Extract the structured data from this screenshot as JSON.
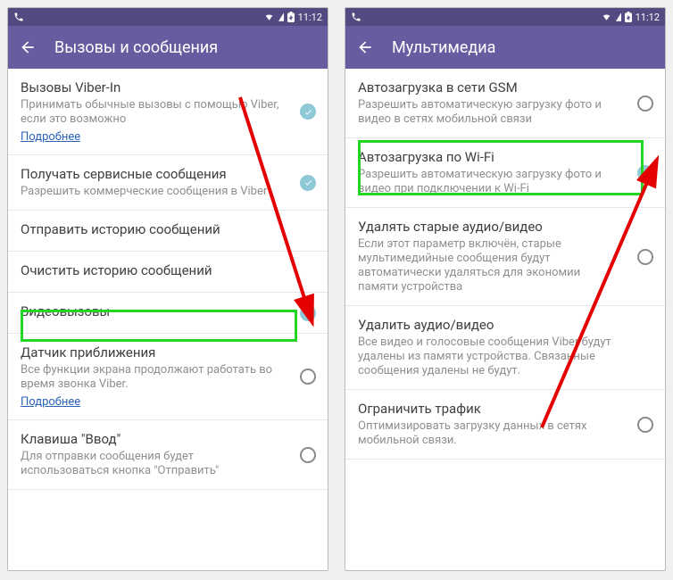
{
  "status": {
    "time": "11:12"
  },
  "left": {
    "title": "Вызовы и сообщения",
    "items": [
      {
        "title": "Вызовы Viber-In",
        "sub": "Принимать обычные вызовы с помощью Viber, если это возможно",
        "link": "Подробнее",
        "ctrl": "check"
      },
      {
        "title": "Получать сервисные сообщения",
        "sub": "Разрешить коммерческие сообщения в Viber",
        "ctrl": "check"
      },
      {
        "title": "Отправить историю сообщений",
        "ctrl": "none"
      },
      {
        "title": "Очистить историю сообщений",
        "ctrl": "none"
      },
      {
        "title": "Видеовызовы",
        "ctrl": "check"
      },
      {
        "title": "Датчик приближения",
        "sub": "Все функции экрана продолжают работать во время звонка Viber.",
        "link": "Подробнее",
        "ctrl": "radio"
      },
      {
        "title": "Клавиша \"Ввод\"",
        "sub": "Для отправки сообщения будет использоваться кнопка \"Отправить\"",
        "ctrl": "radio"
      }
    ]
  },
  "right": {
    "title": "Мультимедиа",
    "items": [
      {
        "title": "Автозагрузка в сети GSM",
        "sub": "Разрешить автоматическую загрузку фото и видео в сетях мобильной связи",
        "ctrl": "radio"
      },
      {
        "title": "Автозагрузка по Wi-Fi",
        "sub": "Разрешить автоматическую загрузку фото и видео при подключении к Wi-Fi",
        "ctrl": "check"
      },
      {
        "title": "Удалять старые аудио/видео",
        "sub": "Если этот параметр включён, старые мультимедийные сообщения будут автоматически удаляться для экономии памяти устройства",
        "ctrl": "radio"
      },
      {
        "title": "Удалить аудио/видео",
        "sub": "Все видео и голосовые сообщения Viber будут удалены из памяти устройства. Связанные сообщения удалены не будут.",
        "ctrl": "none"
      },
      {
        "title": "Ограничить трафик",
        "sub": "Оптимизировать загрузку данных в сетях мобильной связи.",
        "ctrl": "radio"
      }
    ]
  }
}
